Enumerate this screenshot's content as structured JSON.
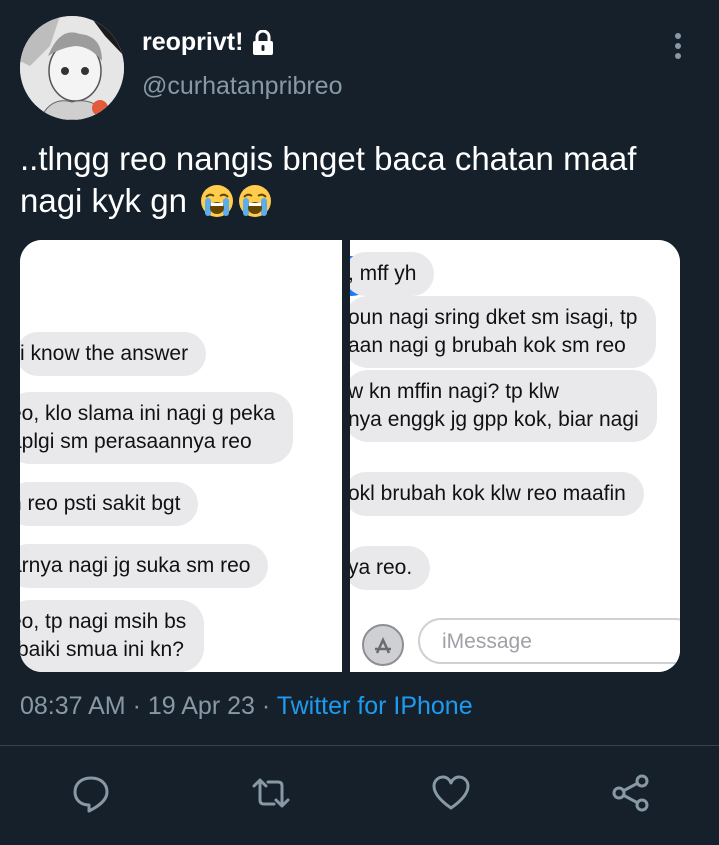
{
  "author": {
    "display_name": "reoprivt!",
    "handle": "@curhatanpribreo"
  },
  "tweet": {
    "text": "..tlngg reo nangis bnget baca chatan maaf nagi kyk gn",
    "emojis": [
      "loudly-crying-face",
      "loudly-crying-face"
    ]
  },
  "media": {
    "left_panel": {
      "bubbles": [
        [
          "i know the answer"
        ],
        [
          "eo, klo slama ini nagi g peka",
          "aplgi sm perasaannya reo"
        ],
        [
          "n reo psti sakit bgt"
        ],
        [
          "arnya nagi jg suka sm reo"
        ],
        [
          "eo, tp nagi msih bs",
          "rbaiki smua ini kn?"
        ]
      ]
    },
    "right_panel": {
      "bubbles": [
        [
          ", mff yh"
        ],
        [
          "oun nagi sring dket sm isagi, tp",
          "aan nagi g brubah kok sm reo"
        ],
        [
          "w kn mffin nagi? tp klw",
          "nya enggk jg gpp kok, biar nagi"
        ],
        [
          "okl brubah kok klw reo maafin"
        ],
        [
          "ya reo."
        ]
      ],
      "compose_placeholder": "iMessage"
    }
  },
  "meta": {
    "time": "08:37 AM",
    "separator": "·",
    "date": "19 Apr 23",
    "source": "Twitter for IPhone"
  },
  "colors": {
    "background": "#15202b",
    "secondary_text": "#8899a6",
    "link": "#1d9bf0",
    "bubble_gray": "#e9e9eb"
  },
  "icons": [
    "lock-icon",
    "more-icon",
    "reply-icon",
    "retweet-icon",
    "like-icon",
    "share-icon"
  ]
}
